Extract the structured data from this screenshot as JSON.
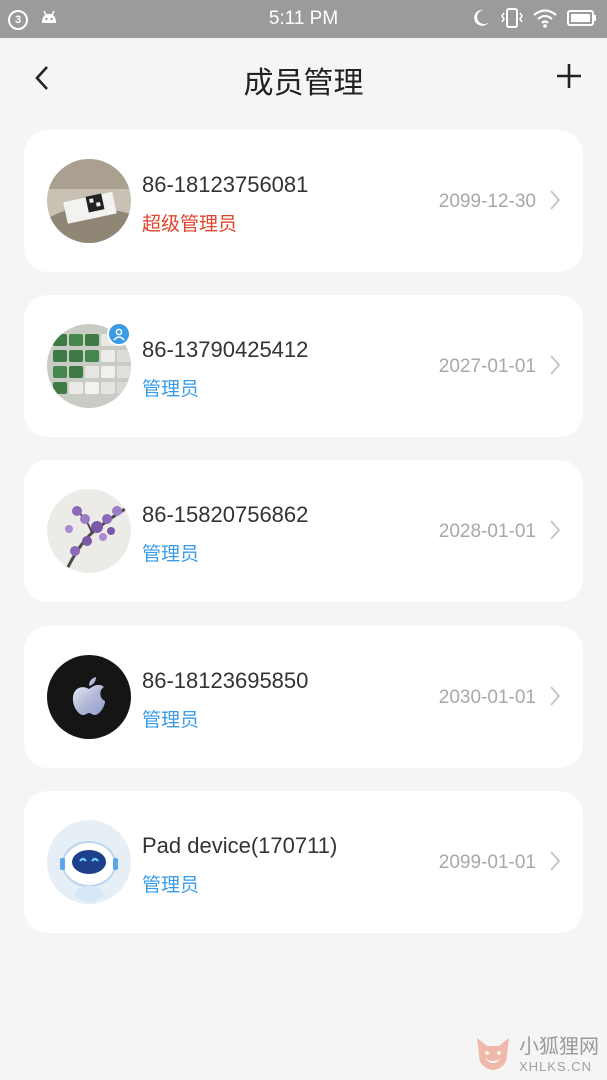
{
  "statusbar": {
    "notification_count": "3",
    "time": "5:11 PM",
    "icons": [
      "android-icon",
      "moon-icon",
      "vibrate-icon",
      "wifi-icon",
      "battery-icon"
    ]
  },
  "header": {
    "title": "成员管理",
    "back_icon": "back-arrow-icon",
    "add_icon": "plus-icon"
  },
  "members": [
    {
      "name": "86-18123756081",
      "role": "超级管理员",
      "role_color": "#e0452c",
      "expiry": "2099-12-30",
      "avatar": "qr-label-photo",
      "admin_badge": false
    },
    {
      "name": "86-13790425412",
      "role": "管理员",
      "role_color": "#3a9be6",
      "expiry": "2027-01-01",
      "avatar": "keyboard-photo",
      "admin_badge": true
    },
    {
      "name": "86-15820756862",
      "role": "管理员",
      "role_color": "#3a9be6",
      "expiry": "2028-01-01",
      "avatar": "flower-painting",
      "admin_badge": false
    },
    {
      "name": "86-18123695850",
      "role": "管理员",
      "role_color": "#3a9be6",
      "expiry": "2030-01-01",
      "avatar": "apple-logo",
      "admin_badge": false
    },
    {
      "name": "Pad device(170711)",
      "role": "管理员",
      "role_color": "#3a9be6",
      "expiry": "2099-01-01",
      "avatar": "robot-mascot",
      "admin_badge": false
    }
  ],
  "watermark": {
    "cn": "小狐狸网",
    "en": "XHLKS.CN"
  }
}
